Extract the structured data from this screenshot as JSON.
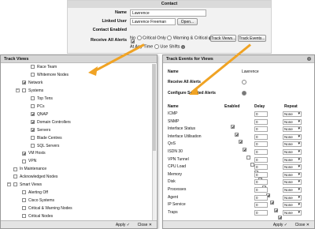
{
  "contact": {
    "title": "Contact",
    "name_label": "Name",
    "name_value": "Lawrence",
    "linked_user_label": "Linked User",
    "linked_user_value": "Lawrence Freeman",
    "open_button": "Open...",
    "contact_enabled_label": "Contact Enabled",
    "receive_label": "Receive All Alerts",
    "opt_no": "No",
    "opt_critical": "Critical Only",
    "opt_warning": "Warning & Critical",
    "track_views_button": "Track Views...",
    "track_events_button": "Track Events...",
    "any_time": "At Any Time",
    "use_shifts": "Use Shifts"
  },
  "left_panel": {
    "title": "Track Views",
    "apply": "Apply ✓",
    "close": "Close ✕",
    "items": [
      {
        "label": "Race Team",
        "checked": false,
        "level": 2
      },
      {
        "label": "Whitemore Nodes",
        "checked": false,
        "level": 2
      },
      {
        "label": "Network",
        "checked": true,
        "level": 1
      },
      {
        "label": "Systems",
        "checked": false,
        "level": 1,
        "toggle": "−"
      },
      {
        "label": "Top Tens",
        "checked": false,
        "level": 2
      },
      {
        "label": "PCs",
        "checked": false,
        "level": 2
      },
      {
        "label": "QNAP",
        "checked": true,
        "level": 2
      },
      {
        "label": "Domain Controllers",
        "checked": true,
        "level": 2
      },
      {
        "label": "Servers",
        "checked": true,
        "level": 2
      },
      {
        "label": "Blade Centres",
        "checked": false,
        "level": 2
      },
      {
        "label": "SQL Servers",
        "checked": false,
        "level": 2
      },
      {
        "label": "VM Hosts",
        "checked": true,
        "level": 1
      },
      {
        "label": "VPN",
        "checked": false,
        "level": 1
      },
      {
        "label": "In Maintenance",
        "checked": false,
        "level": 0
      },
      {
        "label": "Acknowledged Nodes",
        "checked": false,
        "level": 0
      },
      {
        "label": "Smart Views",
        "checked": false,
        "level": 0,
        "toggle": "−"
      },
      {
        "label": "Alerting Off",
        "checked": false,
        "level": 1
      },
      {
        "label": "Cisco Systems",
        "checked": false,
        "level": 1
      },
      {
        "label": "Critical & Warning Nodes",
        "checked": false,
        "level": 1
      },
      {
        "label": "Critical Nodes",
        "checked": false,
        "level": 1
      }
    ]
  },
  "right_panel": {
    "title": "Track Events for Views",
    "name_label": "Name",
    "name_value": "Lawrence",
    "receive_label": "Receive All Alerts",
    "configure_label": "Configure Selected Alerts",
    "col_name": "Name",
    "col_enabled": "Enabled",
    "col_delay": "Delay",
    "col_repeat": "Repeat",
    "apply": "Apply ✓",
    "close": "Close ✕",
    "events": [
      {
        "name": "ICMP",
        "enabled": true,
        "delay": "0",
        "repeat": "None"
      },
      {
        "name": "SNMP",
        "enabled": true,
        "delay": "0",
        "repeat": "None"
      },
      {
        "name": "Interface Status",
        "enabled": true,
        "delay": "0",
        "repeat": "None"
      },
      {
        "name": "Interface Utilisation",
        "enabled": true,
        "delay": "0",
        "repeat": "None"
      },
      {
        "name": "QoS",
        "enabled": false,
        "delay": "0",
        "repeat": "None"
      },
      {
        "name": "ISDN 30",
        "enabled": false,
        "delay": "0",
        "repeat": "None"
      },
      {
        "name": "VPN Tunnel",
        "enabled": true,
        "delay": "0",
        "repeat": "None"
      },
      {
        "name": "CPU Load",
        "enabled": true,
        "delay": "0",
        "repeat": "None"
      },
      {
        "name": "Memory",
        "enabled": true,
        "delay": "0",
        "repeat": "None"
      },
      {
        "name": "Disk",
        "enabled": true,
        "delay": "0",
        "repeat": "None"
      },
      {
        "name": "Processes",
        "enabled": true,
        "delay": "0",
        "repeat": "None"
      },
      {
        "name": "Agent",
        "enabled": true,
        "delay": "0",
        "repeat": "None"
      },
      {
        "name": "IP Service",
        "enabled": true,
        "delay": "0",
        "repeat": "None"
      },
      {
        "name": "Traps",
        "enabled": true,
        "delay": "0",
        "repeat": "None"
      }
    ]
  },
  "colors": {
    "arrow": "#f0a324",
    "header": "#d6d6d6"
  }
}
